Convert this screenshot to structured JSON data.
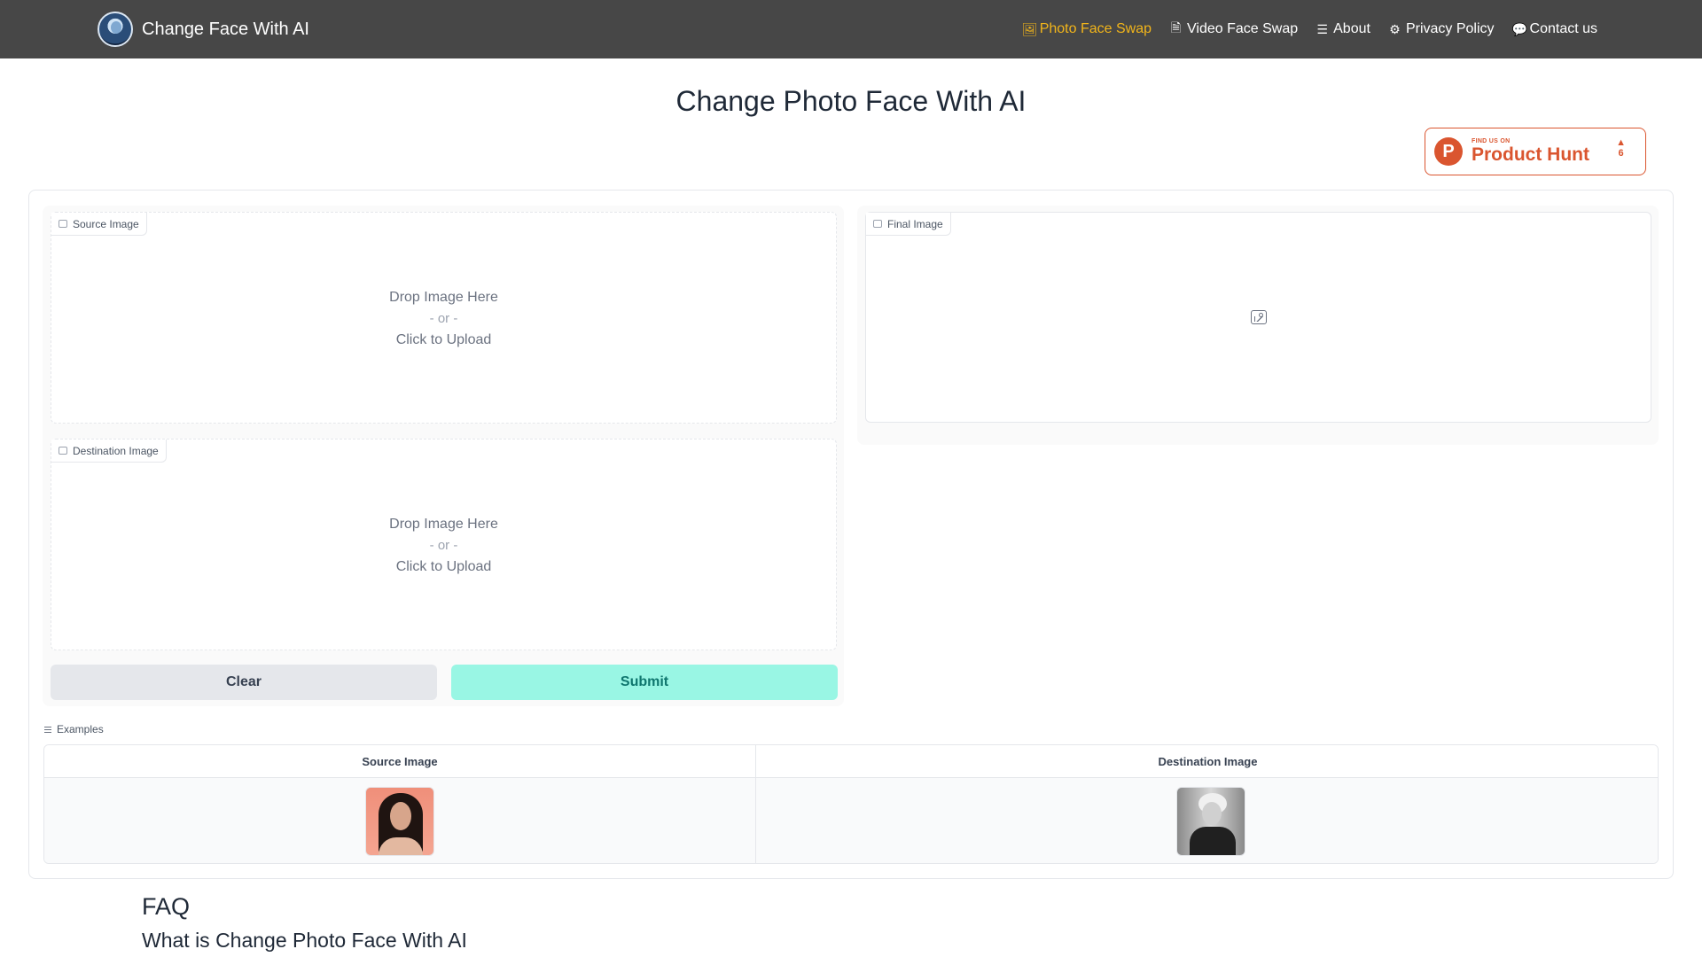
{
  "nav": {
    "brand": "Change Face With AI",
    "links": [
      {
        "label": "Photo Face Swap",
        "icon": "image-file-icon",
        "active": true
      },
      {
        "label": "Video Face Swap",
        "icon": "video-file-icon",
        "active": false
      },
      {
        "label": "About",
        "icon": "list-icon",
        "active": false
      },
      {
        "label": "Privacy Policy",
        "icon": "lock-icon",
        "active": false
      },
      {
        "label": "Contact us",
        "icon": "chat-bubble-icon",
        "active": false
      }
    ]
  },
  "page": {
    "title": "Change Photo Face With AI"
  },
  "product_hunt": {
    "small": "FIND US ON",
    "big": "Product Hunt",
    "votes": "6"
  },
  "source_upload": {
    "label": "Source Image",
    "drop": "Drop Image Here",
    "or": "- or -",
    "click": "Click to Upload"
  },
  "destination_upload": {
    "label": "Destination Image",
    "drop": "Drop Image Here",
    "or": "- or -",
    "click": "Click to Upload"
  },
  "final": {
    "label": "Final Image"
  },
  "buttons": {
    "clear": "Clear",
    "submit": "Submit"
  },
  "examples": {
    "label": "Examples",
    "headers": [
      "Source Image",
      "Destination Image"
    ]
  },
  "faq": {
    "title": "FAQ",
    "question": "What is Change Photo Face With AI"
  },
  "colors": {
    "nav_bg": "#474747",
    "active_link": "#f2b51a",
    "product_hunt": "#da552f",
    "submit_bg": "#99f6e4",
    "submit_text": "#0f766e"
  }
}
